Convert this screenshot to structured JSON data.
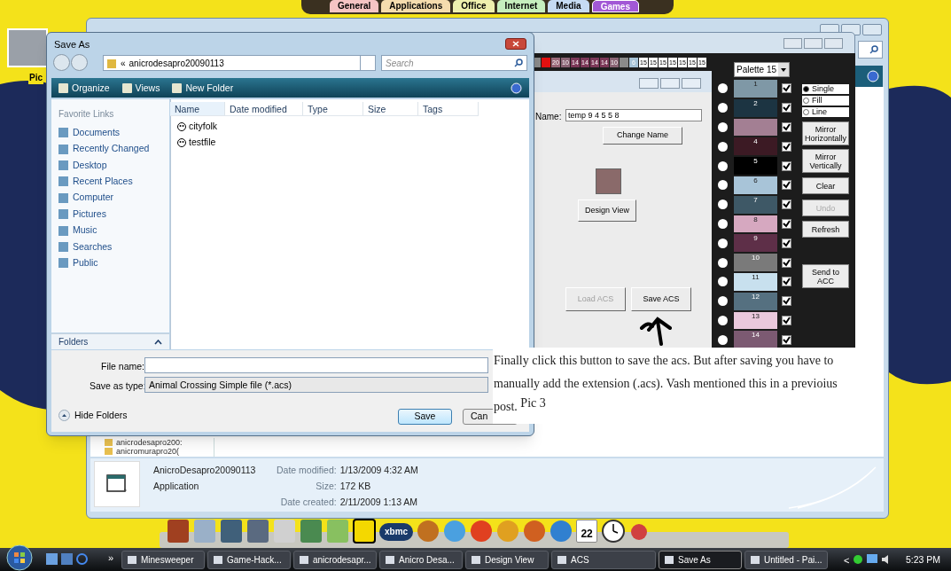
{
  "top_tabs": [
    {
      "label": "General",
      "color": "#f6c4c4",
      "selected": false
    },
    {
      "label": "Applications",
      "color": "#f5dcae",
      "selected": false
    },
    {
      "label": "Office",
      "color": "#eef0ae",
      "selected": false
    },
    {
      "label": "Internet",
      "color": "#c6efbe",
      "selected": false
    },
    {
      "label": "Media",
      "color": "#c6dbf3",
      "selected": false
    },
    {
      "label": "Games",
      "color": "#a257d6",
      "selected": true
    }
  ],
  "desktop_icon": {
    "label": "Pic"
  },
  "explorer": {
    "folders": [
      "anicrodesapro200:",
      "anicromurapro20("
    ],
    "details": {
      "name": "AnicroDesapro20090113",
      "type": "Application",
      "fields": [
        {
          "label": "Date modified:",
          "value": "1/13/2009 4:32 AM"
        },
        {
          "label": "Size:",
          "value": "172 KB"
        },
        {
          "label": "Date created:",
          "value": "2/11/2009 1:13 AM"
        }
      ]
    }
  },
  "acs_window": {
    "strip": [
      {
        "color": "#8a8a8a"
      },
      {
        "color": "#e01010"
      },
      {
        "text": "20",
        "color": "#9a6878"
      },
      {
        "text": "10",
        "color": "#8a6474"
      },
      {
        "text": "14",
        "color": "#7c3858"
      },
      {
        "text": "14",
        "color": "#7c3858"
      },
      {
        "text": "14",
        "color": "#7c3858"
      },
      {
        "text": "14",
        "color": "#7c3858"
      },
      {
        "text": "10",
        "color": "#8a6474"
      },
      {
        "color": "#8a8a8a"
      },
      {
        "text": "6",
        "color": "#a8c4d8"
      },
      {
        "text": "15",
        "color": "#ffffff"
      },
      {
        "text": "15",
        "color": "#ffffff"
      },
      {
        "text": "15",
        "color": "#ffffff"
      },
      {
        "text": "15",
        "color": "#ffffff"
      },
      {
        "text": "15",
        "color": "#ffffff"
      },
      {
        "text": "15",
        "color": "#ffffff"
      },
      {
        "text": "15",
        "color": "#ffffff"
      }
    ],
    "name_label": "Name:",
    "name_value": "temp 9 4 5 5 8",
    "change_name": "Change Name",
    "design_view": "Design View",
    "load": {
      "label": "Load ACS",
      "disabled": true
    },
    "save": {
      "label": "Save ACS",
      "disabled": false
    },
    "palette_select": "Palette 15",
    "swatches": [
      {
        "label": "1",
        "color": "#7f98a6",
        "checked": true,
        "selected": false
      },
      {
        "label": "2",
        "color": "#1c3442",
        "checked": true,
        "selected": false
      },
      {
        "color": "#a37f93",
        "checked": true,
        "selected": false
      },
      {
        "label": "4",
        "color": "#3c1a24",
        "checked": true,
        "selected": false
      },
      {
        "label": "5",
        "color": "#000000",
        "checked": true,
        "selected": false
      },
      {
        "label": "6",
        "color": "#a8c4d8",
        "checked": true,
        "selected": false
      },
      {
        "label": "7",
        "color": "#3e5866",
        "checked": true,
        "selected": false
      },
      {
        "label": "8",
        "color": "#d6a8c0",
        "checked": true,
        "selected": false
      },
      {
        "label": "9",
        "color": "#5e2f48",
        "checked": true,
        "selected": false
      },
      {
        "label": "10",
        "color": "#7a7a7a",
        "checked": true,
        "selected": false
      },
      {
        "label": "11",
        "color": "#c8e0ee",
        "checked": true,
        "selected": false
      },
      {
        "label": "12",
        "color": "#557080",
        "checked": true,
        "selected": false
      },
      {
        "label": "13",
        "color": "#eac8dc",
        "checked": true,
        "selected": false
      },
      {
        "label": "14",
        "color": "#7c5a72",
        "checked": true,
        "selected": false
      }
    ],
    "modes": [
      {
        "label": "Single",
        "selected": true
      },
      {
        "label": "Fill",
        "selected": false
      },
      {
        "label": "Line",
        "selected": false
      }
    ],
    "tools": [
      {
        "label": "Mirror Horizontally",
        "disabled": false
      },
      {
        "label": "Mirror Vertically",
        "disabled": false
      },
      {
        "label": "Clear",
        "disabled": false
      },
      {
        "label": "Undo",
        "disabled": true
      },
      {
        "label": "Refresh",
        "disabled": false
      },
      {
        "label": "Send to ACC",
        "disabled": false
      }
    ]
  },
  "save_dialog": {
    "title": "Save As",
    "path_prefix": "«",
    "path": "anicrodesapro20090113",
    "search_placeholder": "Search",
    "toolbar": [
      "Organize",
      "Views",
      "New Folder"
    ],
    "favorites_heading": "Favorite Links",
    "links": [
      "Documents",
      "Recently Changed",
      "Desktop",
      "Recent Places",
      "Computer",
      "Pictures",
      "Music",
      "Searches",
      "Public"
    ],
    "columns": [
      "Name",
      "Date modified",
      "Type",
      "Size",
      "Tags"
    ],
    "files": [
      "cityfolk",
      "testfile"
    ],
    "folders_label": "Folders",
    "file_name_label": "File name:",
    "type_label": "Save as type:",
    "type_value": "Animal Crossing Simple file (*.acs)",
    "hide_folders": "Hide Folders",
    "save": "Save",
    "cancel": "Can"
  },
  "caption": {
    "text": "Finally click this button to save the acs. But after saving you have to manually add the extension (.acs). Vash mentioned this in a previoius post.",
    "pic": "Pic 3"
  },
  "dock": {
    "logo_text": "xbmc",
    "calendar_day": "22"
  },
  "taskbar": {
    "items": [
      {
        "label": "Minesweeper",
        "selected": false
      },
      {
        "label": "Game-Hack...",
        "selected": false
      },
      {
        "label": "anicrodesapr...",
        "selected": false
      },
      {
        "label": "Anicro Desa...",
        "selected": false
      },
      {
        "label": "Design View",
        "selected": false
      },
      {
        "label": "ACS",
        "selected": false
      },
      {
        "label": "Save As",
        "selected": true
      },
      {
        "label": "Untitled - Pai...",
        "selected": false
      }
    ],
    "overflow": "»",
    "scroll": "<",
    "clock": "5:23 PM"
  }
}
